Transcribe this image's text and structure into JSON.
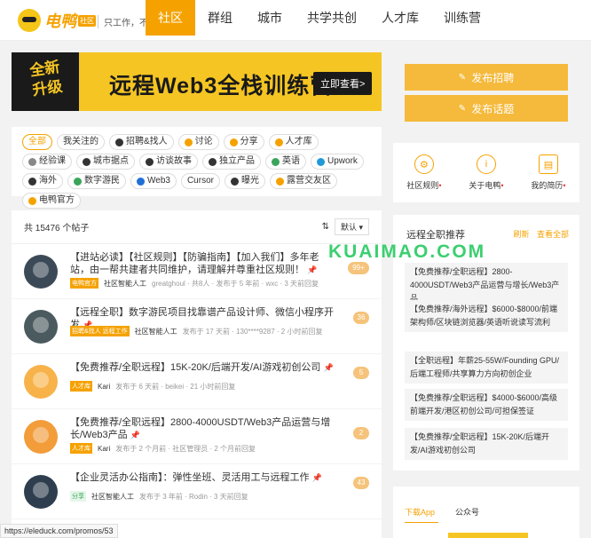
{
  "header": {
    "logo_text": "电鸭",
    "logo_badge": "社区",
    "slogan": "只工作，不上班",
    "nav": [
      "社区",
      "群组",
      "城市",
      "共学共创",
      "人才库",
      "训练营"
    ]
  },
  "banner": {
    "badge": "全新\n升级",
    "title": "远程Web3全栈训练营",
    "cta": "立即查看>"
  },
  "tags": [
    "全部",
    "我关注的",
    "招聘&找人",
    "讨论",
    "分享",
    "人才库",
    "经验课",
    "城市据点",
    "访谈故事",
    "独立产品",
    "英语",
    "Upwork",
    "海外",
    "数字游民",
    "Web3",
    "Cursor",
    "曝光",
    "露营交友区",
    "电鸭官方"
  ],
  "posts_header": {
    "count": "共 15476 个帖子",
    "sort": "默认"
  },
  "posts": [
    {
      "title": "【进站必读】【社区规则】【防骗指南】【加入我们】多年老站，由一帮共建者共同维护，请理解并尊重社区规则！",
      "tag": "电鸭官方",
      "author": "社区智能人工",
      "meta": "greatghoul · 共8人 · 发布于 5 年前 · wxc · 3 天前回复",
      "replies": "99+"
    },
    {
      "title": "【远程全职】数字游民项目找靠谱产品设计师、微信小程序开发",
      "tag": "招聘&找人 远程工作",
      "author": "社区智能人工",
      "meta": "发布于 17 天前 · 130****9287 · 2 小时前回复",
      "replies": "36"
    },
    {
      "title": "【免费推荐/全职远程】15K-20K/后端开发/AI游戏初创公司",
      "tag": "人才库",
      "author": "Kari",
      "meta": "发布于 6 天前 · beikei · 21 小时前回复",
      "replies": "5"
    },
    {
      "title": "【免费推荐/全职远程】2800-4000USDT/Web3产品运营与增长/Web3产品",
      "tag": "人才库",
      "author": "Kari",
      "meta": "发布于 2 个月前 · 社区管理员 · 2 个月前回复",
      "replies": "2"
    },
    {
      "title": "【企业灵活办公指南】：弹性坐班、灵活用工与远程工作",
      "tag": "分享",
      "author": "社区智能人工",
      "meta": "发布于 3 年前 · Rodin · 3 天前回复",
      "replies": "43"
    }
  ],
  "right": {
    "btn_post_job": "发布招聘",
    "btn_post_topic": "发布话题",
    "quick_links": [
      "社区规则",
      "关于电鸭",
      "我的简历"
    ],
    "rec_title": "远程全职推荐",
    "rec_refresh": "刷新",
    "rec_view_all": "查看全部",
    "rec_items": [
      "【免费推荐/全职远程】2800-4000USDT/Web3产品运营与增长/Web3产品",
      "【免费推荐/海外远程】$6000-$8000/前端架构师/区块链浏览器/英语听说读写流利",
      "【全职远程】年薪25-55W/Founding GPU/后端工程师/共享算力方向初创企业",
      "【免费推荐/全职远程】$4000-$6000/高级前端开发/港区初创公司/可担保签证",
      "【免费推荐/全职远程】15K-20K/后端开发/AI游戏初创公司"
    ],
    "dl_tabs": [
      "下载App",
      "公众号"
    ]
  },
  "watermark": "KUAIMAO.COM",
  "status_url": "https://eleduck.com/promos/53",
  "colors": {
    "accent": "#f5a200",
    "button": "#f5b93b",
    "banner": "#f5c523"
  }
}
